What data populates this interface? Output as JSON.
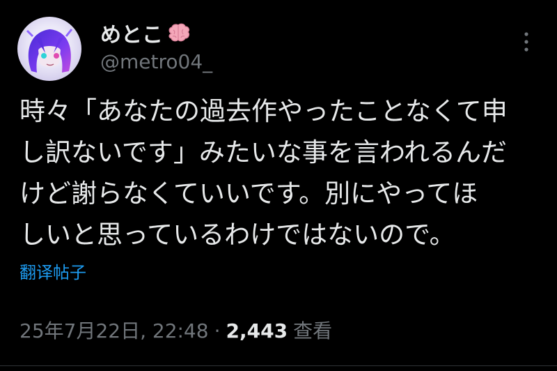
{
  "author": {
    "display_name": "めとこ",
    "handle": "@metro04_",
    "name_emoji": "brain-icon"
  },
  "tweet": {
    "text_lines": [
      "時々「あなたの過去作やったことなくて申",
      "し訳ないです」みたいな事を言われるんだ",
      "けど謝らなくていいです。別にやってほ",
      "しいと思っているわけではないので。"
    ],
    "translate_label": "翻译帖子"
  },
  "meta": {
    "timestamp": "25年7月22日, 22:48",
    "separator": "·",
    "views_count": "2,443",
    "views_label": "查看"
  },
  "colors": {
    "background": "#000000",
    "text": "#e7e9ea",
    "secondary": "#71767b",
    "link": "#1d9bf0",
    "brain": "#f4a7b9"
  },
  "icons": {
    "more": "vertical-ellipsis-icon",
    "brain": "brain-icon",
    "avatar": "avatar-anime-character"
  }
}
